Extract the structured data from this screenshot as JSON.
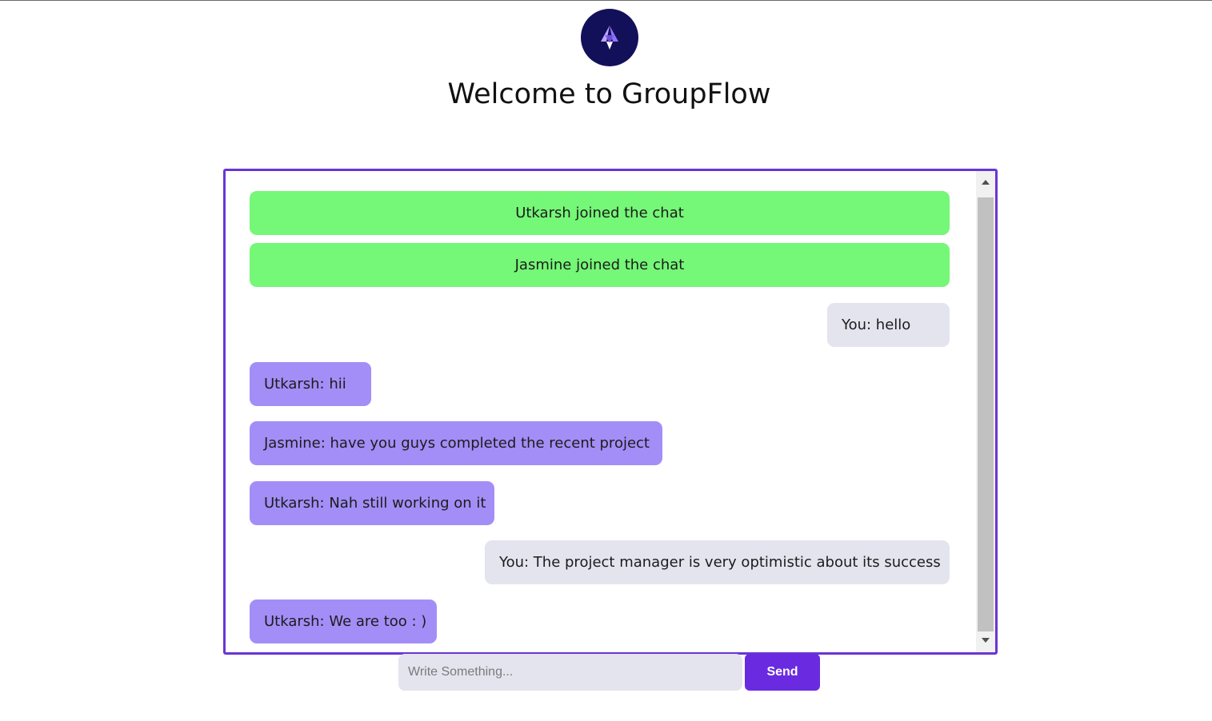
{
  "app": {
    "title": "Welcome to GroupFlow",
    "logo_icon": "groupflow-logo-icon"
  },
  "colors": {
    "accent": "#6a35d4",
    "send_button": "#6a2be0",
    "logo_background": "#13105a",
    "system_message": "#75f777",
    "incoming_message": "#a38ef7",
    "outgoing_message": "#e3e4ee"
  },
  "chat": {
    "messages": [
      {
        "type": "system",
        "text": "Utkarsh joined the chat"
      },
      {
        "type": "system",
        "text": "Jasmine joined the chat"
      },
      {
        "type": "outgoing",
        "text": "You: hello"
      },
      {
        "type": "incoming",
        "text": "Utkarsh: hii"
      },
      {
        "type": "incoming",
        "text": "Jasmine: have you guys completed the recent project"
      },
      {
        "type": "incoming",
        "text": "Utkarsh: Nah still working on it"
      },
      {
        "type": "outgoing",
        "text": "You: The project manager is very optimistic about its success"
      },
      {
        "type": "incoming",
        "text": "Utkarsh: We are too : )"
      }
    ],
    "scroll_up_icon": "triangle-up-icon",
    "scroll_down_icon": "triangle-down-icon"
  },
  "composer": {
    "placeholder": "Write Something...",
    "value": "",
    "send_label": "Send"
  }
}
